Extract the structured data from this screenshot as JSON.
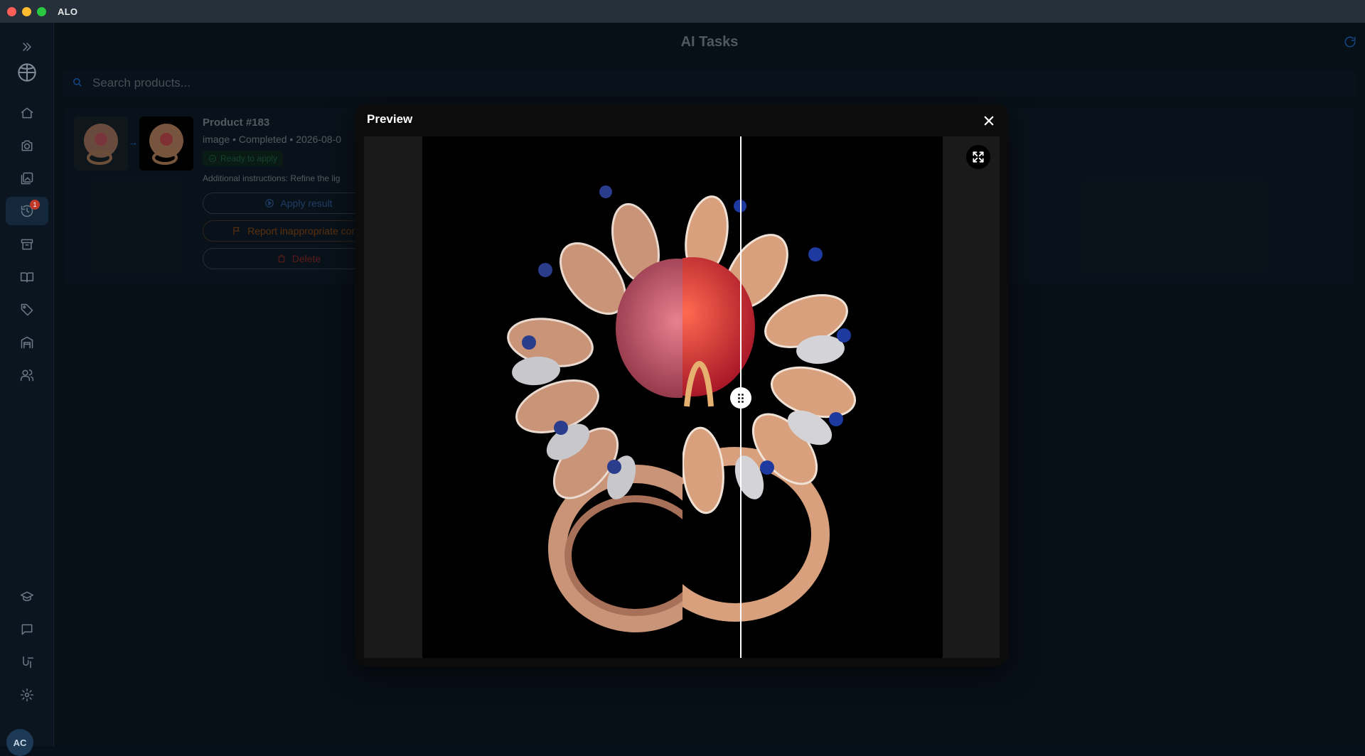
{
  "app": {
    "title": "ALO"
  },
  "header": {
    "title": "AI Tasks"
  },
  "search": {
    "placeholder": "Search products..."
  },
  "sidebar": {
    "items": [
      {
        "name": "expand",
        "icon": "chevrons-right-icon"
      },
      {
        "name": "brand",
        "icon": "globe-logo-icon"
      },
      {
        "name": "home",
        "icon": "home-icon"
      },
      {
        "name": "camera",
        "icon": "camera-icon"
      },
      {
        "name": "gallery",
        "icon": "gallery-icon"
      },
      {
        "name": "ai-tasks",
        "icon": "history-icon",
        "badge": "1"
      },
      {
        "name": "archive",
        "icon": "archive-icon"
      },
      {
        "name": "catalog",
        "icon": "book-icon"
      },
      {
        "name": "tags",
        "icon": "tag-icon"
      },
      {
        "name": "warehouse",
        "icon": "warehouse-icon"
      },
      {
        "name": "users",
        "icon": "users-icon"
      },
      {
        "name": "learn",
        "icon": "graduation-cap-icon"
      },
      {
        "name": "chat",
        "icon": "chat-icon"
      },
      {
        "name": "integrations",
        "icon": "integrations-icon"
      },
      {
        "name": "settings",
        "icon": "gear-icon"
      }
    ],
    "avatar_initials": "AC"
  },
  "task": {
    "title": "Product #183",
    "meta": "image • Completed • 2026-08-0",
    "status": "Ready to apply",
    "instructions": "Additional instructions: Refine the lig",
    "apply_label": "Apply result",
    "report_label": "Report inappropriate con...",
    "delete_label": "Delete"
  },
  "modal": {
    "title": "Preview"
  },
  "colors": {
    "accent": "#1f6fd1",
    "danger": "#c0392b",
    "success": "#1f6a45",
    "warning": "#8a4a14"
  }
}
